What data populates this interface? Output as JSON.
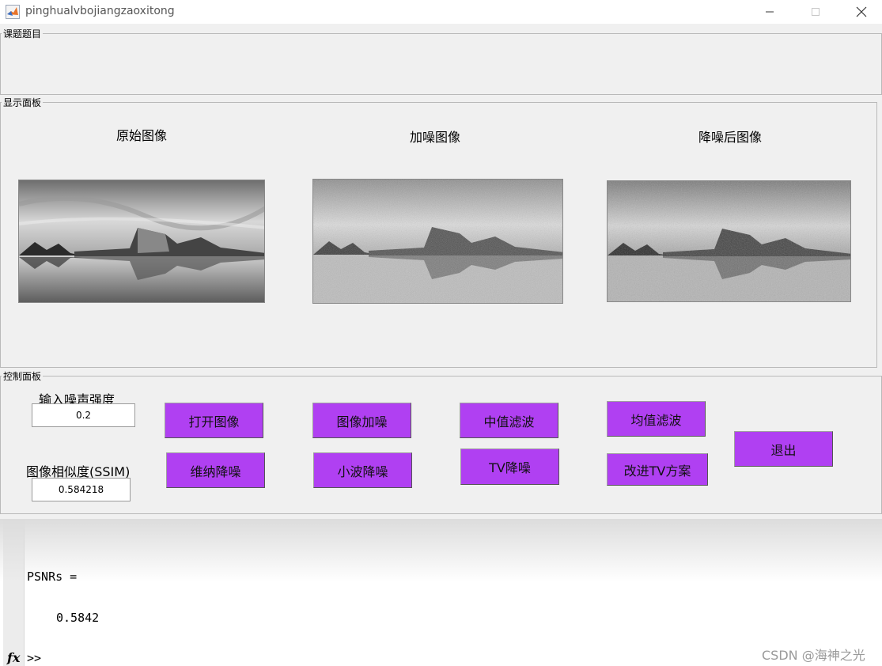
{
  "window": {
    "title": "pinghualvbojiangzaoxitong",
    "icon": "matlab-icon"
  },
  "panels": {
    "topic": "课题题目",
    "display": "显示面板",
    "control": "控制面板"
  },
  "images": [
    {
      "title": "原始图像",
      "kind": "original"
    },
    {
      "title": "加噪图像",
      "kind": "noisy"
    },
    {
      "title": "降噪后图像",
      "kind": "denoised"
    }
  ],
  "controls": {
    "noise_label": "输入噪声强度",
    "noise_value": "0.2",
    "ssim_label": "图像相似度(SSIM)",
    "ssim_value": "0.584218",
    "buttons": {
      "open": "打开图像",
      "add_noise": "图像加噪",
      "median": "中值滤波",
      "mean": "均值滤波",
      "exit": "退出",
      "wiener": "维纳降噪",
      "wavelet": "小波降噪",
      "tv": "TV降噪",
      "improved_tv": "改进TV方案"
    },
    "button_color": "#b040f2"
  },
  "console": {
    "line1": "PSNRs =",
    "line2": "0.5842",
    "prompt": ">>",
    "fx": "fx"
  },
  "watermark": "CSDN @海神之光"
}
